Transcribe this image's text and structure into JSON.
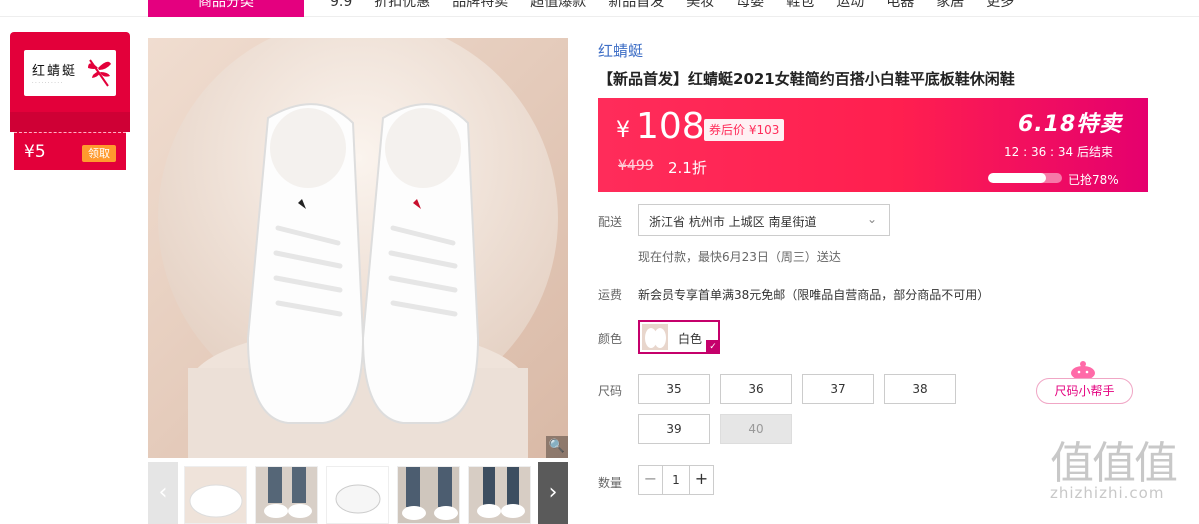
{
  "nav": {
    "active_tab": "商品分类",
    "items": [
      "9.9",
      "折扣优惠",
      "品牌特卖",
      "超值爆款",
      "新品首发",
      "美妆",
      "母婴",
      "鞋包",
      "运动",
      "电器",
      "家居",
      "更多"
    ]
  },
  "coupon": {
    "brand_logo_text": "红蜻蜓",
    "amount": "¥5",
    "claim_label": "领取"
  },
  "product": {
    "brand": "红蜻蜓",
    "title": "【新品首发】红蜻蜓2021女鞋简约百搭小白鞋平底板鞋休闲鞋",
    "yen": "¥",
    "price": "108",
    "coupon_price": "券后价 ¥103",
    "original_price": "¥499",
    "discount": "2.1折",
    "sale_title": "6.18特卖",
    "countdown": "12 : 36 : 34  后结束",
    "sold_ratio": 0.78,
    "sold_label": "已抢78%"
  },
  "delivery": {
    "label": "配送",
    "location": "浙江省 杭州市 上城区 南星街道",
    "note": "现在付款，最快6月23日（周三）送达"
  },
  "shipping": {
    "label": "运费",
    "text": "新会员专享首单满38元免邮（限唯品自营商品，部分商品不可用）"
  },
  "color": {
    "label": "颜色",
    "selected": "白色"
  },
  "size": {
    "label": "尺码",
    "options": [
      "35",
      "36",
      "37",
      "38",
      "39",
      "40"
    ],
    "unavailable": [
      "40"
    ],
    "helper_label": "尺码小帮手"
  },
  "quantity": {
    "label": "数量",
    "value": "1",
    "minus": "−",
    "plus": "+"
  },
  "thumbs": {
    "prev": "‹",
    "next": "›"
  },
  "zoom_glyph": "🔍",
  "watermark": {
    "logo": "值值值",
    "url": "zhizhizhi.com"
  }
}
